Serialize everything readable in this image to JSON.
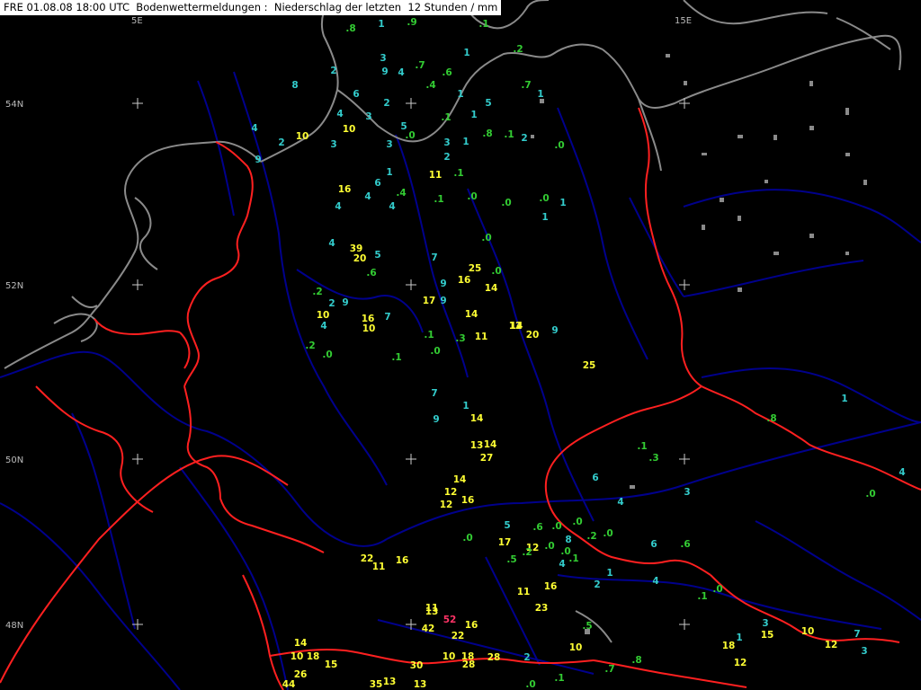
{
  "header": {
    "title": "FRE 01.08.08 18:00 UTC  Bodenwettermeldungen :  Niederschlag der letzten  12 Stunden / mm"
  },
  "grid": {
    "lat_labels": [
      "54N",
      "52N",
      "50N",
      "48N"
    ],
    "lon_labels": [
      "5E",
      "15E"
    ]
  },
  "colors": {
    "background": "#000000",
    "coast": "#8a8a8a",
    "border": "#ff2020",
    "river": "#000090",
    "class_zero": "#33cc33",
    "class_small": "#33cccc",
    "class_medium": "#ffff33",
    "class_high": "#ff3366",
    "grid_cross": "#cccccc"
  },
  "observations": [
    {
      "v": ".8",
      "c": "g"
    },
    {
      "v": "1",
      "c": "c"
    },
    {
      "v": ".9",
      "c": "g"
    },
    {
      "v": ".1",
      "c": "g"
    },
    {
      "v": ".2",
      "c": "g"
    },
    {
      "v": "1",
      "c": "c"
    },
    {
      "v": "8",
      "c": "c"
    },
    {
      "v": "2",
      "c": "c"
    },
    {
      "v": "3",
      "c": "c"
    },
    {
      "v": "9",
      "c": "c"
    },
    {
      "v": "4",
      "c": "c"
    },
    {
      "v": ".7",
      "c": "g"
    },
    {
      "v": ".6",
      "c": "g"
    },
    {
      "v": "1",
      "c": "c"
    },
    {
      "v": ".4",
      "c": "g"
    },
    {
      "v": ".1",
      "c": "g"
    },
    {
      "v": "6",
      "c": "c"
    },
    {
      "v": "2",
      "c": "c"
    },
    {
      "v": "4",
      "c": "c"
    },
    {
      "v": "5",
      "c": "c"
    },
    {
      "v": "1",
      "c": "c"
    },
    {
      "v": ".7",
      "c": "g"
    },
    {
      "v": "1",
      "c": "c"
    },
    {
      "v": "3",
      "c": "c"
    },
    {
      "v": "5",
      "c": "c"
    },
    {
      "v": ".0",
      "c": "g"
    },
    {
      "v": "4",
      "c": "c"
    },
    {
      "v": "2",
      "c": "c"
    },
    {
      "v": "10",
      "c": "y"
    },
    {
      "v": "10",
      "c": "y"
    },
    {
      "v": "3",
      "c": "c"
    },
    {
      "v": "3",
      "c": "c"
    },
    {
      "v": "2",
      "c": "c"
    },
    {
      "v": "3",
      "c": "c"
    },
    {
      "v": "1",
      "c": "c"
    },
    {
      "v": ".8",
      "c": "g"
    },
    {
      "v": ".1",
      "c": "g"
    },
    {
      "v": "2",
      "c": "c"
    },
    {
      "v": ".0",
      "c": "g"
    },
    {
      "v": "9",
      "c": "c"
    },
    {
      "v": "1",
      "c": "c"
    },
    {
      "v": "11",
      "c": "y"
    },
    {
      "v": ".1",
      "c": "g"
    },
    {
      "v": "6",
      "c": "c"
    },
    {
      "v": "16",
      "c": "y"
    },
    {
      "v": "4",
      "c": "c"
    },
    {
      "v": ".4",
      "c": "g"
    },
    {
      "v": "4",
      "c": "c"
    },
    {
      "v": "4",
      "c": "c"
    },
    {
      "v": ".1",
      "c": "g"
    },
    {
      "v": ".0",
      "c": "g"
    },
    {
      "v": ".0",
      "c": "g"
    },
    {
      "v": ".0",
      "c": "g"
    },
    {
      "v": "1",
      "c": "c"
    },
    {
      "v": "1",
      "c": "c"
    },
    {
      "v": "39",
      "c": "y"
    },
    {
      "v": "20",
      "c": "y"
    },
    {
      "v": "4",
      "c": "c"
    },
    {
      "v": "5",
      "c": "c"
    },
    {
      "v": "7",
      "c": "c"
    },
    {
      "v": ".0",
      "c": "g"
    },
    {
      "v": "25",
      "c": "y"
    },
    {
      "v": "14",
      "c": "y"
    },
    {
      "v": ".6",
      "c": "g"
    },
    {
      "v": "16",
      "c": "y"
    },
    {
      "v": ".0",
      "c": "g"
    },
    {
      "v": "9",
      "c": "c"
    },
    {
      "v": "14",
      "c": "y"
    },
    {
      "v": ".2",
      "c": "g"
    },
    {
      "v": "9",
      "c": "c"
    },
    {
      "v": "2",
      "c": "c"
    },
    {
      "v": "17",
      "c": "y"
    },
    {
      "v": "9",
      "c": "c"
    },
    {
      "v": "10",
      "c": "y"
    },
    {
      "v": "16",
      "c": "y"
    },
    {
      "v": "7",
      "c": "c"
    },
    {
      "v": "14",
      "c": "y"
    },
    {
      "v": "4",
      "c": "c"
    },
    {
      "v": "10",
      "c": "y"
    },
    {
      "v": "12",
      "c": "y"
    },
    {
      "v": "20",
      "c": "y"
    },
    {
      "v": ".1",
      "c": "g"
    },
    {
      "v": ".3",
      "c": "g"
    },
    {
      "v": "11",
      "c": "y"
    },
    {
      "v": "9",
      "c": "c"
    },
    {
      "v": ".2",
      "c": "g"
    },
    {
      "v": ".0",
      "c": "g"
    },
    {
      "v": ".1",
      "c": "g"
    },
    {
      "v": ".0",
      "c": "g"
    },
    {
      "v": "25",
      "c": "y"
    },
    {
      "v": "7",
      "c": "c"
    },
    {
      "v": "9",
      "c": "c"
    },
    {
      "v": "1",
      "c": "c"
    },
    {
      "v": "14",
      "c": "y"
    },
    {
      "v": "13",
      "c": "y"
    },
    {
      "v": "27",
      "c": "y"
    },
    {
      "v": "14",
      "c": "y"
    },
    {
      "v": "12",
      "c": "y"
    },
    {
      "v": "14",
      "c": "y"
    },
    {
      "v": "12",
      "c": "y"
    },
    {
      "v": "16",
      "c": "y"
    },
    {
      "v": "17",
      "c": "y"
    },
    {
      "v": "12",
      "c": "y"
    },
    {
      "v": "22",
      "c": "y"
    },
    {
      "v": "11",
      "c": "y"
    },
    {
      "v": "16",
      "c": "y"
    },
    {
      "v": "16",
      "c": "y"
    },
    {
      "v": "23",
      "c": "y"
    },
    {
      "v": "11",
      "c": "y"
    },
    {
      "v": "11",
      "c": "y"
    },
    {
      "v": "13",
      "c": "y"
    },
    {
      "v": "52",
      "c": "r"
    },
    {
      "v": "42",
      "c": "y"
    },
    {
      "v": "22",
      "c": "y"
    },
    {
      "v": "16",
      "c": "y"
    },
    {
      "v": "10",
      "c": "y"
    },
    {
      "v": "18",
      "c": "y"
    },
    {
      "v": "28",
      "c": "y"
    },
    {
      "v": "28",
      "c": "y"
    },
    {
      "v": "30",
      "c": "y"
    },
    {
      "v": "14",
      "c": "y"
    },
    {
      "v": "10",
      "c": "y"
    },
    {
      "v": "18",
      "c": "y"
    },
    {
      "v": "15",
      "c": "y"
    },
    {
      "v": "26",
      "c": "y"
    },
    {
      "v": "44",
      "c": "y"
    },
    {
      "v": "35",
      "c": "y"
    },
    {
      "v": "13",
      "c": "y"
    },
    {
      "v": "13",
      "c": "y"
    },
    {
      "v": "10",
      "c": "y"
    },
    {
      "v": "18",
      "c": "y"
    },
    {
      "v": "12",
      "c": "y"
    },
    {
      "v": "15",
      "c": "y"
    },
    {
      "v": "10",
      "c": "y"
    },
    {
      "v": "12",
      "c": "y"
    },
    {
      "v": "3",
      "c": "c"
    },
    {
      "v": "1",
      "c": "c"
    },
    {
      "v": "7",
      "c": "c"
    },
    {
      "v": "3",
      "c": "c"
    },
    {
      "v": "4",
      "c": "c"
    },
    {
      "v": ".0",
      "c": "g"
    },
    {
      "v": ".8",
      "c": "g"
    },
    {
      "v": "1",
      "c": "c"
    },
    {
      "v": "4",
      "c": "c"
    },
    {
      "v": ".1",
      "c": "g"
    },
    {
      "v": ".0",
      "c": "g"
    },
    {
      "v": ".6",
      "c": "g"
    },
    {
      "v": "6",
      "c": "c"
    },
    {
      "v": "3",
      "c": "c"
    },
    {
      "v": ".3",
      "c": "g"
    },
    {
      "v": ".1",
      "c": "g"
    },
    {
      "v": "4",
      "c": "c"
    },
    {
      "v": "6",
      "c": "c"
    },
    {
      "v": ".0",
      "c": "g"
    },
    {
      "v": ".2",
      "c": "g"
    },
    {
      "v": "1",
      "c": "c"
    },
    {
      "v": "2",
      "c": "c"
    },
    {
      "v": ".5",
      "c": "g"
    },
    {
      "v": ".7",
      "c": "g"
    },
    {
      "v": ".8",
      "c": "g"
    },
    {
      "v": ".1",
      "c": "g"
    },
    {
      "v": ".0",
      "c": "g"
    },
    {
      "v": "2",
      "c": "c"
    },
    {
      "v": ".0",
      "c": "g"
    },
    {
      "v": "5",
      "c": "c"
    },
    {
      "v": ".6",
      "c": "g"
    },
    {
      "v": ".0",
      "c": "g"
    },
    {
      "v": "8",
      "c": "c"
    },
    {
      "v": ".0",
      "c": "g"
    },
    {
      "v": ".0",
      "c": "g"
    },
    {
      "v": ".1",
      "c": "g"
    },
    {
      "v": "4",
      "c": "c"
    },
    {
      "v": ".0",
      "c": "g"
    },
    {
      "v": ".2",
      "c": "g"
    },
    {
      "v": ".5",
      "c": "g"
    },
    {
      "v": ".9",
      "c": "g"
    },
    {
      "v": ".2",
      "c": "g"
    },
    {
      "v": ".1",
      "c": "g"
    },
    {
      "v": ".6",
      "c": "g"
    },
    {
      "v": ".4",
      "c": "g"
    },
    {
      "v": ".0",
      "c": "g"
    },
    {
      "v": ".1",
      "c": "g"
    },
    {
      "v": ".3",
      "c": "g"
    },
    {
      "v": ".1",
      "c": "g"
    },
    {
      "v": ".0",
      "c": "g"
    },
    {
      "v": ".6",
      "c": "g"
    },
    {
      "v": ".0",
      "c": "g"
    },
    {
      "v": ".2",
      "c": "g"
    },
    {
      "v": ".4",
      "c": "g"
    },
    {
      "v": "5",
      "c": "c"
    },
    {
      "v": "3",
      "c": "c"
    },
    {
      "v": ".8",
      "c": "g"
    },
    {
      "v": "4",
      "c": "c"
    },
    {
      "v": "6",
      "c": "c"
    },
    {
      "v": ".0",
      "c": "g"
    },
    {
      "v": ".1",
      "c": "g"
    },
    {
      "v": "4",
      "c": "c"
    },
    {
      "v": ".0",
      "c": "g"
    },
    {
      "v": "1",
      "c": "c"
    },
    {
      "v": ".0",
      "c": "g"
    },
    {
      "v": ".1",
      "c": "g"
    },
    {
      "v": "2",
      "c": "c"
    },
    {
      "v": ".7",
      "c": "g"
    },
    {
      "v": "4",
      "c": "c"
    },
    {
      "v": "5",
      "c": "c"
    }
  ]
}
